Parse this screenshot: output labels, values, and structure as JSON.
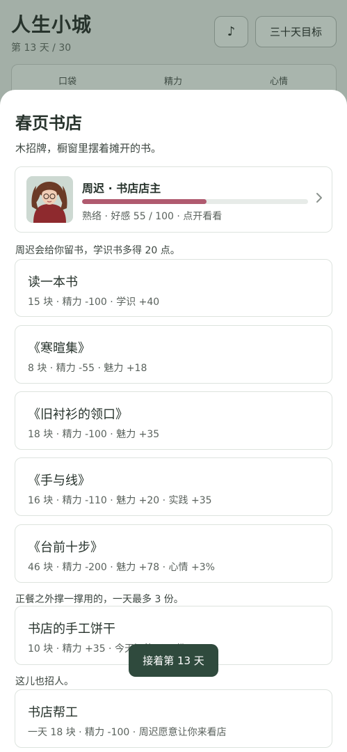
{
  "header": {
    "app_title": "人生小城",
    "day_counter": "第 13 天 / 30",
    "music_icon_glyph": "♪",
    "goals_label": "三十天目标"
  },
  "stats": {
    "pocket_label": "口袋",
    "energy_label": "精力",
    "mood_label": "心情"
  },
  "shop": {
    "title": "春页书店",
    "description": "木招牌，橱窗里摆着摊开的书。",
    "npc": {
      "name": "周迟 · 书店店主",
      "status": "熟络 · 好感 55 / 100 · 点开看看",
      "affinity_value": 55,
      "affinity_max": 100,
      "affinity_color": "#b05a6f"
    },
    "books_note": "周迟会给你留书，学识书多得 20 点。",
    "books": [
      {
        "title": "读一本书",
        "detail": "15 块 · 精力 -100 · 学识 +40"
      },
      {
        "title": "《寒暄集》",
        "detail": "8 块 · 精力 -55 · 魅力 +18"
      },
      {
        "title": "《旧衬衫的领口》",
        "detail": "18 块 · 精力 -100 · 魅力 +35"
      },
      {
        "title": "《手与线》",
        "detail": "16 块 · 精力 -110 · 魅力 +20 · 实践 +35"
      },
      {
        "title": "《台前十步》",
        "detail": "46 块 · 精力 -200 · 魅力 +78 · 心情 +3%"
      }
    ],
    "snack_note": "正餐之外撑一撑用的，一天最多 3 份。",
    "snack": {
      "title": "书店的手工饼干",
      "detail": "10 块 · 精力 +35 · 今天还能买 3 份"
    },
    "job_note": "这儿也招人。",
    "job": {
      "title": "书店帮工",
      "detail": "一天 18 块 · 精力 -100 · 周迟愿意让你来看店"
    }
  },
  "toast": {
    "label": "接着第 13 天"
  },
  "colors": {
    "accent_dark": "#2f4a3d",
    "affinity_bar": "#b05a6f",
    "backdrop": "#a3afa7"
  }
}
